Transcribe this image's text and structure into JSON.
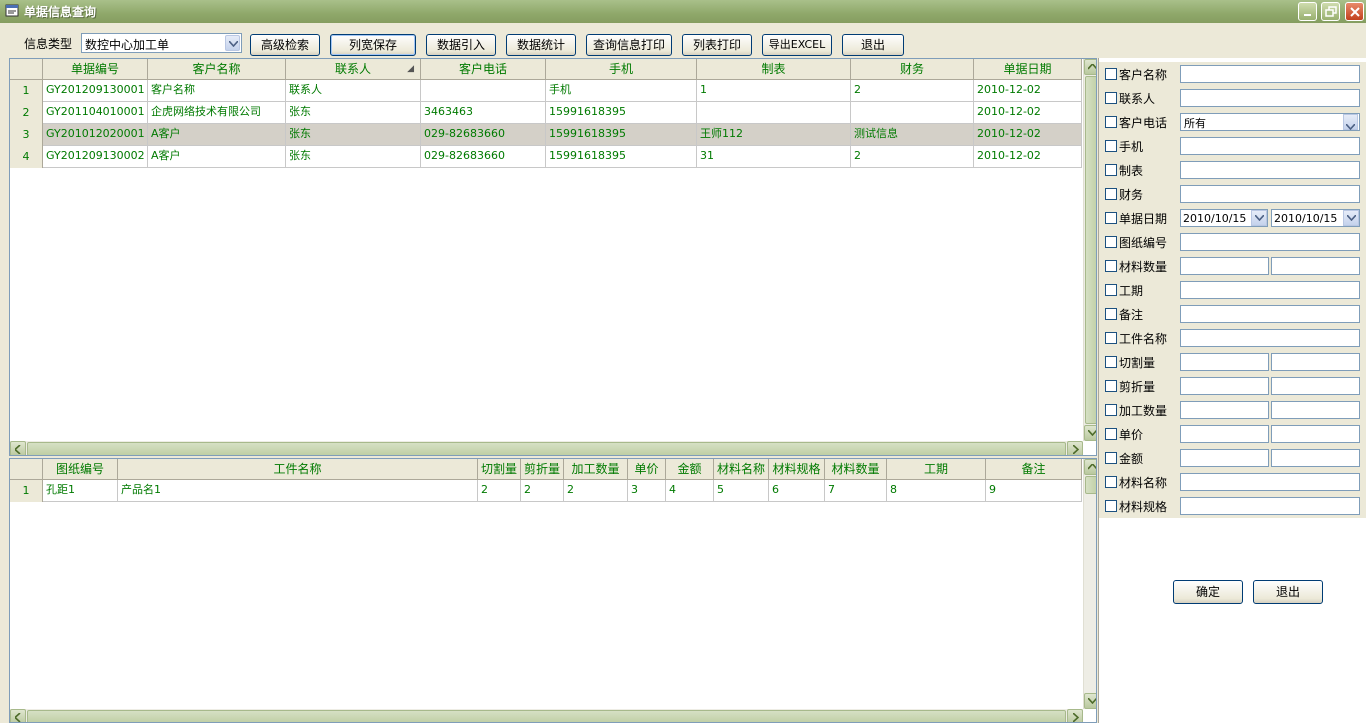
{
  "window": {
    "title": "单据信息查询"
  },
  "toolbar": {
    "type_label": "信息类型",
    "type_value": "数控中心加工单",
    "buttons": [
      "高级检索",
      "列宽保存",
      "数据引入",
      "数据统计",
      "查询信息打印",
      "列表打印",
      "导出EXCEL",
      "退出"
    ]
  },
  "top_grid": {
    "columns": [
      "单据编号",
      "客户名称",
      "联系人",
      "客户电话",
      "手机",
      "制表",
      "财务",
      "单据日期"
    ],
    "rows": [
      {
        "n": "1",
        "cells": [
          "GY201209130001",
          "客户名称",
          "联系人",
          "",
          "手机",
          "1",
          "2",
          "2010-12-02"
        ]
      },
      {
        "n": "2",
        "cells": [
          "GY201104010001",
          "企虎网络技术有限公司",
          "张东",
          "3463463",
          "15991618395",
          "",
          "",
          "2010-12-02"
        ]
      },
      {
        "n": "3",
        "cells": [
          "GY201012020001",
          "A客户",
          "张东",
          "029-82683660",
          "15991618395",
          "王师112",
          "测试信息",
          "2010-12-02"
        ]
      },
      {
        "n": "4",
        "cells": [
          "GY201209130002",
          "A客户",
          "张东",
          "029-82683660",
          "15991618395",
          "31",
          "2",
          "2010-12-02"
        ]
      }
    ]
  },
  "bottom_grid": {
    "columns": [
      "图纸编号",
      "工件名称",
      "切割量",
      "剪折量",
      "加工数量",
      "单价",
      "金额",
      "材料名称",
      "材料规格",
      "材料数量",
      "工期",
      "备注"
    ],
    "rows": [
      {
        "n": "1",
        "cells": [
          "孔距1",
          "产品名1",
          "2",
          "2",
          "2",
          "3",
          "4",
          "5",
          "6",
          "7",
          "8",
          "9"
        ]
      }
    ]
  },
  "filter_panel": {
    "fields": [
      {
        "label": "客户名称"
      },
      {
        "label": "联系人"
      },
      {
        "label": "客户电话",
        "select": "所有"
      },
      {
        "label": "手机"
      },
      {
        "label": "制表"
      },
      {
        "label": "财务"
      },
      {
        "label": "单据日期",
        "from": "2010/10/15",
        "to": "2010/10/15"
      },
      {
        "label": "图纸编号"
      },
      {
        "label": "材料数量"
      },
      {
        "label": "工期"
      },
      {
        "label": "备注"
      },
      {
        "label": "工件名称"
      },
      {
        "label": "切割量"
      },
      {
        "label": "剪折量"
      },
      {
        "label": "加工数量"
      },
      {
        "label": "单价"
      },
      {
        "label": "金额"
      },
      {
        "label": "材料名称"
      },
      {
        "label": "材料规格"
      }
    ],
    "ok_label": "确定",
    "exit_label": "退出"
  }
}
